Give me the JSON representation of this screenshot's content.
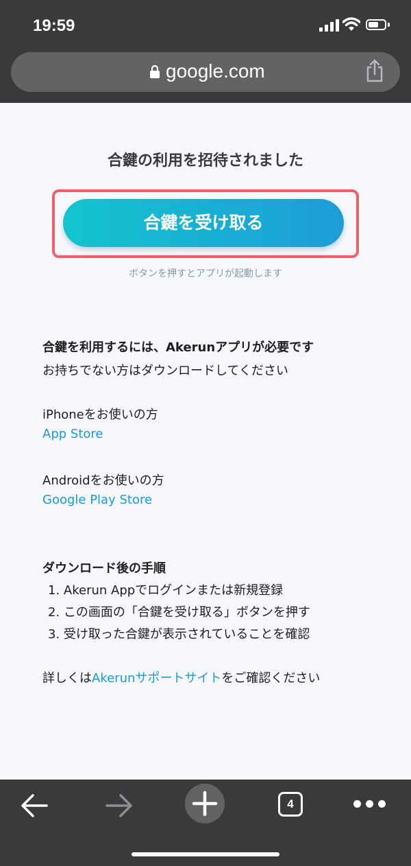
{
  "status_bar": {
    "time": "19:59"
  },
  "browser": {
    "url": "google.com",
    "tab_count": "4"
  },
  "page": {
    "headline": "合鍵の利用を招待されました",
    "receive_button": "合鍵を受け取る",
    "button_hint": "ボタンを押すとアプリが起動します",
    "app_required": "合鍵を利用するには、Akerunアプリが必要です",
    "download_prompt": "お持ちでない方はダウンロードしてください",
    "iphone_label": "iPhoneをお使いの方",
    "app_store_link": "App Store",
    "android_label": "Androidをお使いの方",
    "play_store_link": "Google Play Store",
    "steps_title": "ダウンロード後の手順",
    "steps": [
      "1. Akerun Appでログインまたは新規登録",
      "2. この画面の「合鍵を受け取る」ボタンを押す",
      "3. 受け取った合鍵が表示されていることを確認"
    ],
    "support_prefix": "詳しくは",
    "support_link": "Akerunサポートサイト",
    "support_suffix": "をご確認ください"
  },
  "colors": {
    "accent_gradient_start": "#13c4cf",
    "accent_gradient_end": "#1d9cd6",
    "link": "#1f97d3",
    "highlight": "#f0606a",
    "browser_chrome": "#3a3a3c"
  },
  "icons": [
    "lock-icon",
    "share-icon",
    "back-arrow-icon",
    "forward-arrow-icon",
    "plus-icon",
    "more-icon",
    "wifi-icon",
    "signal-icon",
    "battery-icon"
  ]
}
